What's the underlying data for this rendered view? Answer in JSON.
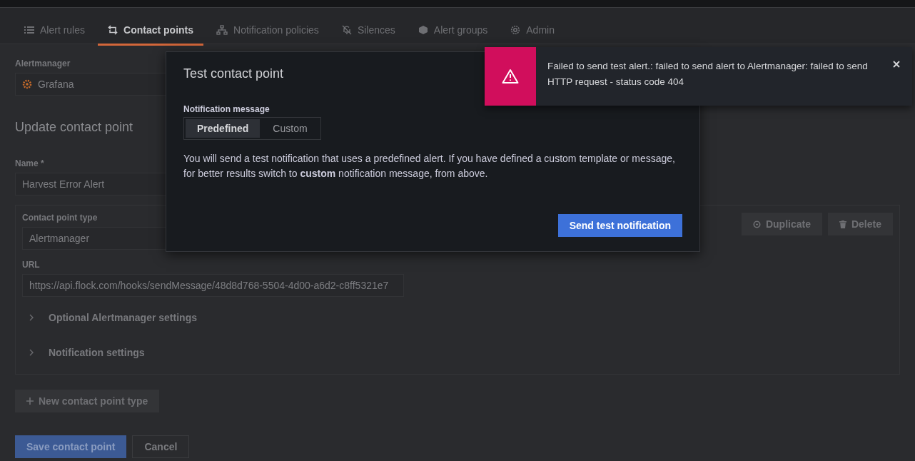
{
  "tabs": [
    {
      "label": "Alert rules",
      "selected": false
    },
    {
      "label": "Contact points",
      "selected": true
    },
    {
      "label": "Notification policies",
      "selected": false
    },
    {
      "label": "Silences",
      "selected": false
    },
    {
      "label": "Alert groups",
      "selected": false
    },
    {
      "label": "Admin",
      "selected": false
    }
  ],
  "alertmanager": {
    "label": "Alertmanager",
    "value": "Grafana"
  },
  "heading": "Update contact point",
  "name_field": {
    "label": "Name *",
    "value": "Harvest Error Alert"
  },
  "contact_point": {
    "type_label": "Contact point type",
    "type_value": "Alertmanager",
    "url_label": "URL",
    "url_value": "https://api.flock.com/hooks/sendMessage/48d8d768-5504-4d00-a6d2-c8ff5321e7",
    "actions": [
      "Duplicate",
      "Delete"
    ],
    "sections": [
      {
        "label": "Optional Alertmanager settings",
        "expanded": false
      },
      {
        "label": "Notification settings",
        "expanded": false
      }
    ]
  },
  "new_type_button": "New contact point type",
  "save_button": "Save contact point",
  "cancel_button": "Cancel",
  "modal": {
    "title": "Test contact point",
    "field_label": "Notification message",
    "options": [
      {
        "label": "Predefined",
        "selected": true
      },
      {
        "label": "Custom",
        "selected": false
      }
    ],
    "description": "You will send a test notification that uses a predefined alert. If you have defined a custom template or message, for better results switch to **custom** notification message, from above.",
    "send_button": "Send test notification"
  },
  "toast": {
    "message": "Failed to send test alert.: failed to send alert to Alertmanager: failed to send HTTP request - status code 404"
  }
}
